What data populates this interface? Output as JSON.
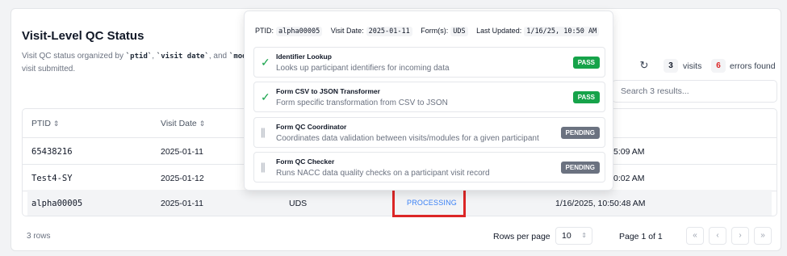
{
  "page": {
    "title": "Visit-Level QC Status",
    "desc_pre": "Visit QC status organized by ",
    "desc_ptid": "`ptid`",
    "desc_sep1": ", ",
    "desc_date": "`visit date`",
    "desc_sep2": ", and ",
    "desc_mod": "`mod",
    "desc_line2": "visit submitted."
  },
  "toolbar": {
    "refresh_icon": "refresh-icon",
    "visits_count": "3",
    "visits_label": "visits",
    "errors_count": "6",
    "errors_label": "errors found",
    "search_placeholder": "Search 3 results..."
  },
  "table": {
    "headers": {
      "ptid": "PTID",
      "visit_date": "Visit Date",
      "sort_glyph": "⇕"
    },
    "rows": [
      {
        "ptid": "65438216",
        "visit_date": "2025-01-11",
        "time_tail": "5:09 AM"
      },
      {
        "ptid": "Test4-SY",
        "visit_date": "2025-01-12",
        "time_tail": "0:02 AM"
      },
      {
        "ptid": "alpha00005",
        "visit_date": "2025-01-11",
        "module": "UDS",
        "status": "PROCESSING",
        "last_updated": "1/16/2025, 10:50:48 AM"
      }
    ]
  },
  "pagination": {
    "rows_count": "3 rows",
    "rows_per_page_label": "Rows per page",
    "rows_per_page_value": "10",
    "page_label": "Page 1 of 1",
    "first": "«",
    "prev": "‹",
    "next": "›",
    "last": "»"
  },
  "popover": {
    "ptid_label": "PTID:",
    "ptid_value": "alpha00005",
    "date_label": "Visit Date:",
    "date_value": "2025-01-11",
    "forms_label": "Form(s):",
    "forms_value": "UDS",
    "updated_label": "Last Updated:",
    "updated_value": "1/16/25, 10:50 AM",
    "steps": [
      {
        "name": "Identifier Lookup",
        "desc": "Looks up participant identifiers for incoming data",
        "status": "PASS",
        "icon": "check-icon"
      },
      {
        "name": "Form CSV to JSON Transformer",
        "desc": "Form specific transformation from CSV to JSON",
        "status": "PASS",
        "icon": "check-icon"
      },
      {
        "name": "Form QC Coordinator",
        "desc": "Coordinates data validation between visits/modules for a given participant",
        "status": "PENDING",
        "icon": "pause-icon"
      },
      {
        "name": "Form QC Checker",
        "desc": "Runs NACC data quality checks on a participant visit record",
        "status": "PENDING",
        "icon": "pause-icon"
      }
    ]
  },
  "colors": {
    "pass": "#16a34a",
    "pending": "#6b7280",
    "error": "#dc2626",
    "processing": "#3b82f6"
  }
}
